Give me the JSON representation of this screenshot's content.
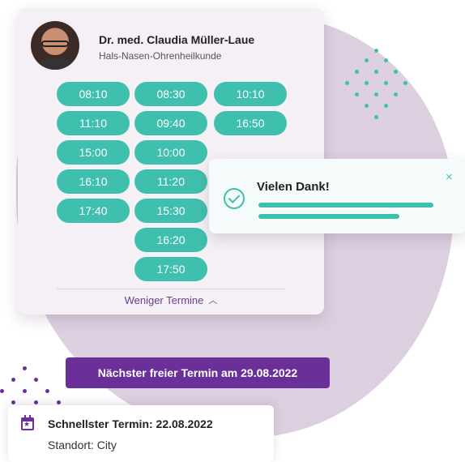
{
  "doctor": {
    "name": "Dr. med. Claudia Müller-Laue",
    "specialty": "Hals-Nasen-Ohrenheilkunde"
  },
  "slots": {
    "col1": [
      "08:10",
      "11:10",
      "15:00",
      "16:10",
      "17:40"
    ],
    "col2": [
      "08:30",
      "09:40",
      "10:00",
      "11:20",
      "15:30",
      "16:20",
      "17:50"
    ],
    "col3": [
      "10:10",
      "16:50"
    ]
  },
  "fewer_label": "Weniger Termine",
  "toast": {
    "title": "Vielen Dank!",
    "close": "×"
  },
  "next_button": "Nächster freier Termin am 29.08.2022",
  "fastest": {
    "title": "Schnellster Termin: 22.08.2022",
    "location": "Standort: City"
  },
  "colors": {
    "teal": "#3fbfae",
    "purple": "#6b2f9a",
    "blob": "#dcd0e0",
    "card": "#f4f0f6"
  }
}
